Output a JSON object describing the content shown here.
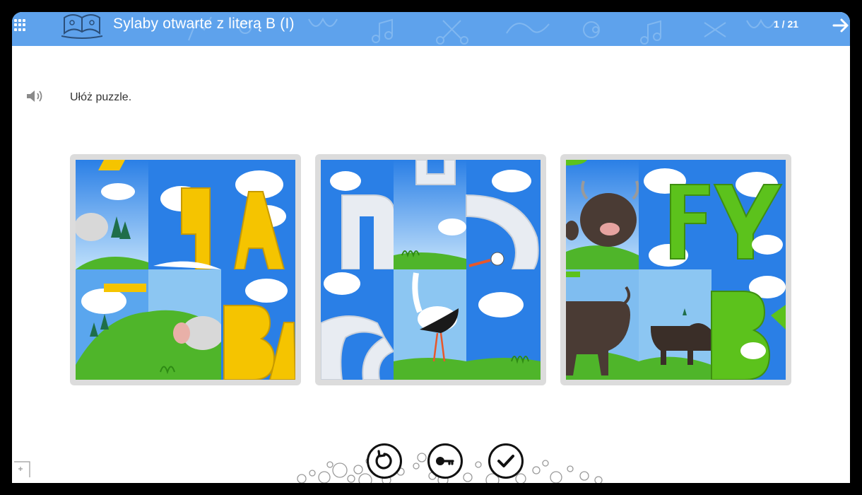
{
  "header": {
    "title": "Sylaby otwarte z literą B (I)",
    "page_counter": "1 / 21",
    "background_color": "#5ea2ec"
  },
  "task": {
    "instruction": "Ułóż puzzle."
  },
  "puzzles": [
    {
      "name": "puzzle-sheep-ba",
      "letters": "BA",
      "letter_color": "#f5c400",
      "animal": "sheep"
    },
    {
      "name": "puzzle-stork-bo",
      "letters": "BO",
      "letter_color": "#e8ecf2",
      "animal": "stork"
    },
    {
      "name": "puzzle-bison-by",
      "letters": "BY",
      "letter_color": "#5cc21c",
      "animal": "bison"
    }
  ],
  "controls": {
    "reset_icon": "reset-icon",
    "key_icon": "key-icon",
    "check_icon": "check-icon"
  },
  "icons": [
    "grid-menu-icon",
    "book-logo-icon",
    "arrow-right-icon",
    "speaker-icon",
    "fullscreen-corner-icon"
  ]
}
